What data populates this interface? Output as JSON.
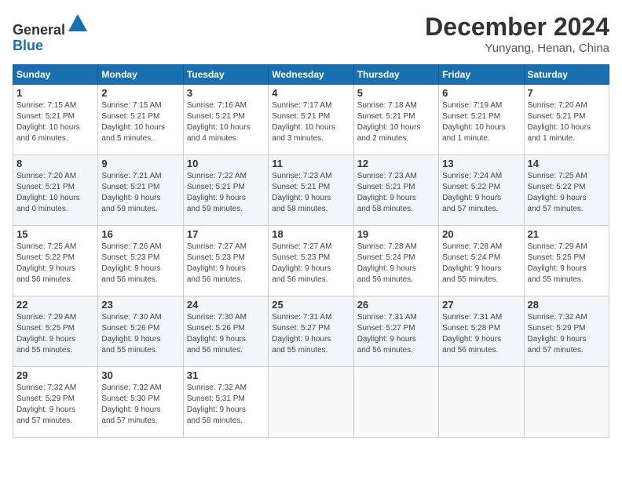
{
  "header": {
    "logo_line1": "General",
    "logo_line2": "Blue",
    "month": "December 2024",
    "location": "Yunyang, Henan, China"
  },
  "days_of_week": [
    "Sunday",
    "Monday",
    "Tuesday",
    "Wednesday",
    "Thursday",
    "Friday",
    "Saturday"
  ],
  "weeks": [
    [
      {
        "day": "1",
        "info": "Sunrise: 7:15 AM\nSunset: 5:21 PM\nDaylight: 10 hours\nand 6 minutes."
      },
      {
        "day": "2",
        "info": "Sunrise: 7:15 AM\nSunset: 5:21 PM\nDaylight: 10 hours\nand 5 minutes."
      },
      {
        "day": "3",
        "info": "Sunrise: 7:16 AM\nSunset: 5:21 PM\nDaylight: 10 hours\nand 4 minutes."
      },
      {
        "day": "4",
        "info": "Sunrise: 7:17 AM\nSunset: 5:21 PM\nDaylight: 10 hours\nand 3 minutes."
      },
      {
        "day": "5",
        "info": "Sunrise: 7:18 AM\nSunset: 5:21 PM\nDaylight: 10 hours\nand 2 minutes."
      },
      {
        "day": "6",
        "info": "Sunrise: 7:19 AM\nSunset: 5:21 PM\nDaylight: 10 hours\nand 1 minute."
      },
      {
        "day": "7",
        "info": "Sunrise: 7:20 AM\nSunset: 5:21 PM\nDaylight: 10 hours\nand 1 minute."
      }
    ],
    [
      {
        "day": "8",
        "info": "Sunrise: 7:20 AM\nSunset: 5:21 PM\nDaylight: 10 hours\nand 0 minutes."
      },
      {
        "day": "9",
        "info": "Sunrise: 7:21 AM\nSunset: 5:21 PM\nDaylight: 9 hours\nand 59 minutes."
      },
      {
        "day": "10",
        "info": "Sunrise: 7:22 AM\nSunset: 5:21 PM\nDaylight: 9 hours\nand 59 minutes."
      },
      {
        "day": "11",
        "info": "Sunrise: 7:23 AM\nSunset: 5:21 PM\nDaylight: 9 hours\nand 58 minutes."
      },
      {
        "day": "12",
        "info": "Sunrise: 7:23 AM\nSunset: 5:21 PM\nDaylight: 9 hours\nand 58 minutes."
      },
      {
        "day": "13",
        "info": "Sunrise: 7:24 AM\nSunset: 5:22 PM\nDaylight: 9 hours\nand 57 minutes."
      },
      {
        "day": "14",
        "info": "Sunrise: 7:25 AM\nSunset: 5:22 PM\nDaylight: 9 hours\nand 57 minutes."
      }
    ],
    [
      {
        "day": "15",
        "info": "Sunrise: 7:25 AM\nSunset: 5:22 PM\nDaylight: 9 hours\nand 56 minutes."
      },
      {
        "day": "16",
        "info": "Sunrise: 7:26 AM\nSunset: 5:23 PM\nDaylight: 9 hours\nand 56 minutes."
      },
      {
        "day": "17",
        "info": "Sunrise: 7:27 AM\nSunset: 5:23 PM\nDaylight: 9 hours\nand 56 minutes."
      },
      {
        "day": "18",
        "info": "Sunrise: 7:27 AM\nSunset: 5:23 PM\nDaylight: 9 hours\nand 56 minutes."
      },
      {
        "day": "19",
        "info": "Sunrise: 7:28 AM\nSunset: 5:24 PM\nDaylight: 9 hours\nand 56 minutes."
      },
      {
        "day": "20",
        "info": "Sunrise: 7:28 AM\nSunset: 5:24 PM\nDaylight: 9 hours\nand 55 minutes."
      },
      {
        "day": "21",
        "info": "Sunrise: 7:29 AM\nSunset: 5:25 PM\nDaylight: 9 hours\nand 55 minutes."
      }
    ],
    [
      {
        "day": "22",
        "info": "Sunrise: 7:29 AM\nSunset: 5:25 PM\nDaylight: 9 hours\nand 55 minutes."
      },
      {
        "day": "23",
        "info": "Sunrise: 7:30 AM\nSunset: 5:26 PM\nDaylight: 9 hours\nand 55 minutes."
      },
      {
        "day": "24",
        "info": "Sunrise: 7:30 AM\nSunset: 5:26 PM\nDaylight: 9 hours\nand 56 minutes."
      },
      {
        "day": "25",
        "info": "Sunrise: 7:31 AM\nSunset: 5:27 PM\nDaylight: 9 hours\nand 55 minutes."
      },
      {
        "day": "26",
        "info": "Sunrise: 7:31 AM\nSunset: 5:27 PM\nDaylight: 9 hours\nand 56 minutes."
      },
      {
        "day": "27",
        "info": "Sunrise: 7:31 AM\nSunset: 5:28 PM\nDaylight: 9 hours\nand 56 minutes."
      },
      {
        "day": "28",
        "info": "Sunrise: 7:32 AM\nSunset: 5:29 PM\nDaylight: 9 hours\nand 57 minutes."
      }
    ],
    [
      {
        "day": "29",
        "info": "Sunrise: 7:32 AM\nSunset: 5:29 PM\nDaylight: 9 hours\nand 57 minutes."
      },
      {
        "day": "30",
        "info": "Sunrise: 7:32 AM\nSunset: 5:30 PM\nDaylight: 9 hours\nand 57 minutes."
      },
      {
        "day": "31",
        "info": "Sunrise: 7:32 AM\nSunset: 5:31 PM\nDaylight: 9 hours\nand 58 minutes."
      },
      {
        "day": "",
        "info": ""
      },
      {
        "day": "",
        "info": ""
      },
      {
        "day": "",
        "info": ""
      },
      {
        "day": "",
        "info": ""
      }
    ]
  ]
}
